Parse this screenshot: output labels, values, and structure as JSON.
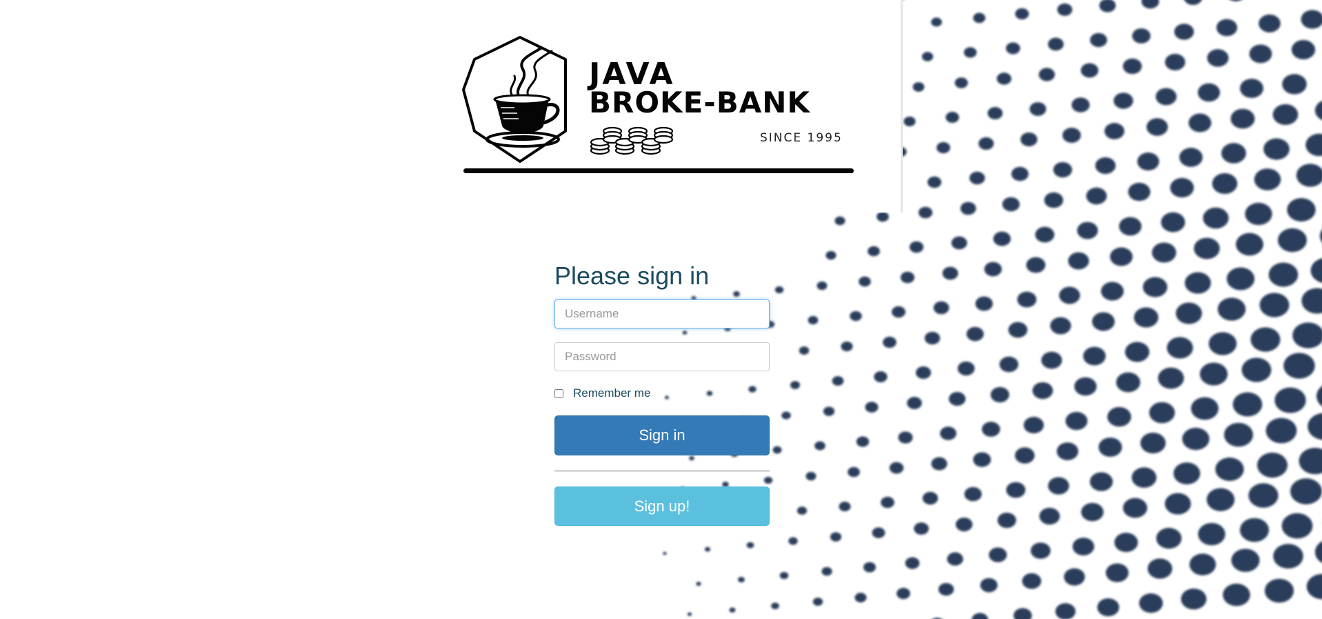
{
  "brand": {
    "line1": "JAVA",
    "line2": "BROKE-BANK",
    "since": "SINCE 1995",
    "icon": "coffee-cup-logo-icon",
    "coins_icon": "coin-stacks-icon"
  },
  "form": {
    "heading": "Please sign in",
    "username_placeholder": "Username",
    "username_value": "",
    "password_placeholder": "Password",
    "password_value": "",
    "remember_label": "Remember me",
    "remember_checked": false,
    "signin_label": "Sign in",
    "signup_label": "Sign up!"
  },
  "colors": {
    "heading": "#1b4a5e",
    "primary_button": "#337ab7",
    "info_button": "#5bc0de",
    "dots": "#2b3e5a",
    "focus_ring": "#66afe9"
  },
  "background": {
    "pattern": "halftone-dots"
  }
}
